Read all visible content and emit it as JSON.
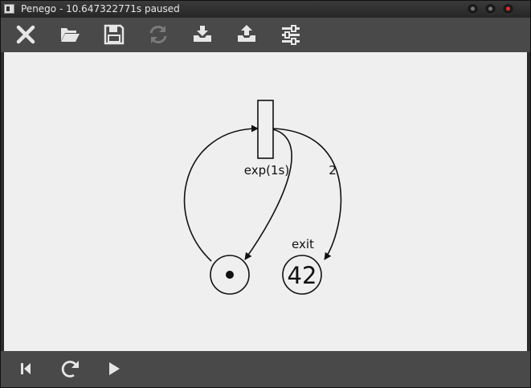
{
  "window": {
    "title": "Penego - 10.647322771s paused"
  },
  "toolbar": {
    "buttons": [
      {
        "name": "close-net-button",
        "icon": "x-icon"
      },
      {
        "name": "open-button",
        "icon": "folder-icon"
      },
      {
        "name": "save-button",
        "icon": "floppy-icon"
      },
      {
        "name": "reload-button",
        "icon": "refresh-icon"
      },
      {
        "name": "import-button",
        "icon": "tray-download-icon"
      },
      {
        "name": "export-button",
        "icon": "tray-upload-icon"
      },
      {
        "name": "settings-button",
        "icon": "sliders-icon"
      }
    ]
  },
  "net": {
    "transition_label": "exp(1s)",
    "arc_weight": "2",
    "place_exit_label": "exit",
    "place_exit_tokens": "42",
    "place_left_tokens": 1
  },
  "bottombar": {
    "buttons": [
      {
        "name": "rewind-button",
        "icon": "skip-back-icon"
      },
      {
        "name": "step-button",
        "icon": "redo-icon"
      },
      {
        "name": "play-button",
        "icon": "play-icon"
      }
    ]
  },
  "colors": {
    "toolbar_bg": "#494949",
    "canvas_bg": "#efefef",
    "icon": "#e6e6e6",
    "icon_disabled": "#7a7a7a"
  }
}
